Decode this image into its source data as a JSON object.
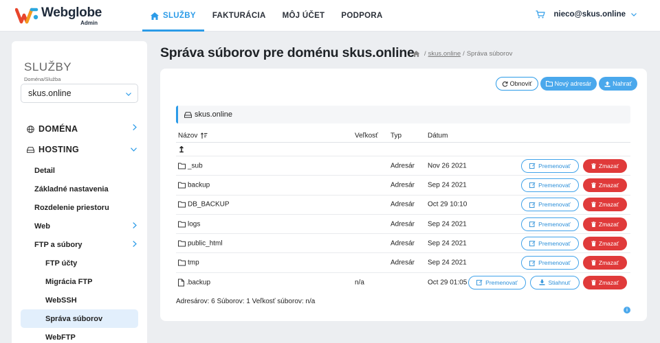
{
  "brand": {
    "name": "Webglobe",
    "subtitle": "Admin"
  },
  "nav": [
    {
      "label": "SLUŽBY",
      "active": true
    },
    {
      "label": "FAKTURÁCIA"
    },
    {
      "label": "MÔJ ÚČET"
    },
    {
      "label": "PODPORA"
    }
  ],
  "account": {
    "email": "nieco@skus.online"
  },
  "sidebar": {
    "title": "SLUŽBY",
    "domain_label": "Doména/Služba",
    "domain_value": "skus.online",
    "menu": {
      "domena": "DOMÉNA",
      "hosting": "HOSTING",
      "detail": "Detail",
      "zakladne": "Základné nastavenia",
      "rozdelenie": "Rozdelenie priestoru",
      "web": "Web",
      "ftp": "FTP a súbory",
      "ftp_ucty": "FTP účty",
      "migracia": "Migrácia FTP",
      "webssh": "WebSSH",
      "sprava": "Správa súborov",
      "webftp": "WebFTP"
    }
  },
  "page": {
    "title": "Správa súborov pre doménu skus.online",
    "breadcrumb": {
      "sep1": "/",
      "link": "skus.online",
      "sep2": "/",
      "current": "Správa súborov"
    }
  },
  "toolbar": {
    "refresh": "Obnoviť",
    "new_dir": "Nový adresár",
    "upload": "Nahrať"
  },
  "dir_header": "skus.online",
  "table": {
    "headers": {
      "name": "Názov",
      "size": "Veľkosť",
      "type": "Typ",
      "date": "Dátum"
    },
    "up": "↥",
    "rows": [
      {
        "name": "_sub",
        "size": "",
        "type": "Adresár",
        "date": "Nov 26 2021",
        "kind": "dir"
      },
      {
        "name": "backup",
        "size": "",
        "type": "Adresár",
        "date": "Sep 24 2021",
        "kind": "dir"
      },
      {
        "name": "DB_BACKUP",
        "size": "",
        "type": "Adresár",
        "date": "Oct 29 10:10",
        "kind": "dir"
      },
      {
        "name": "logs",
        "size": "",
        "type": "Adresár",
        "date": "Sep 24 2021",
        "kind": "dir"
      },
      {
        "name": "public_html",
        "size": "",
        "type": "Adresár",
        "date": "Sep 24 2021",
        "kind": "dir"
      },
      {
        "name": "tmp",
        "size": "",
        "type": "Adresár",
        "date": "Sep 24 2021",
        "kind": "dir"
      },
      {
        "name": ".backup",
        "size": "n/a",
        "type": "",
        "date": "Oct 29 01:05",
        "kind": "file"
      }
    ],
    "actions": {
      "rename": "Premenovať",
      "delete": "Zmazať",
      "download": "Stiahnuť"
    }
  },
  "summary": "Adresárov: 6 Súborov: 1 Veľkosť súborov: n/a",
  "info_glyph": "i",
  "colors": {
    "accent": "#2b9be8",
    "danger": "#e03a3a",
    "active_bg": "#e2effc"
  }
}
